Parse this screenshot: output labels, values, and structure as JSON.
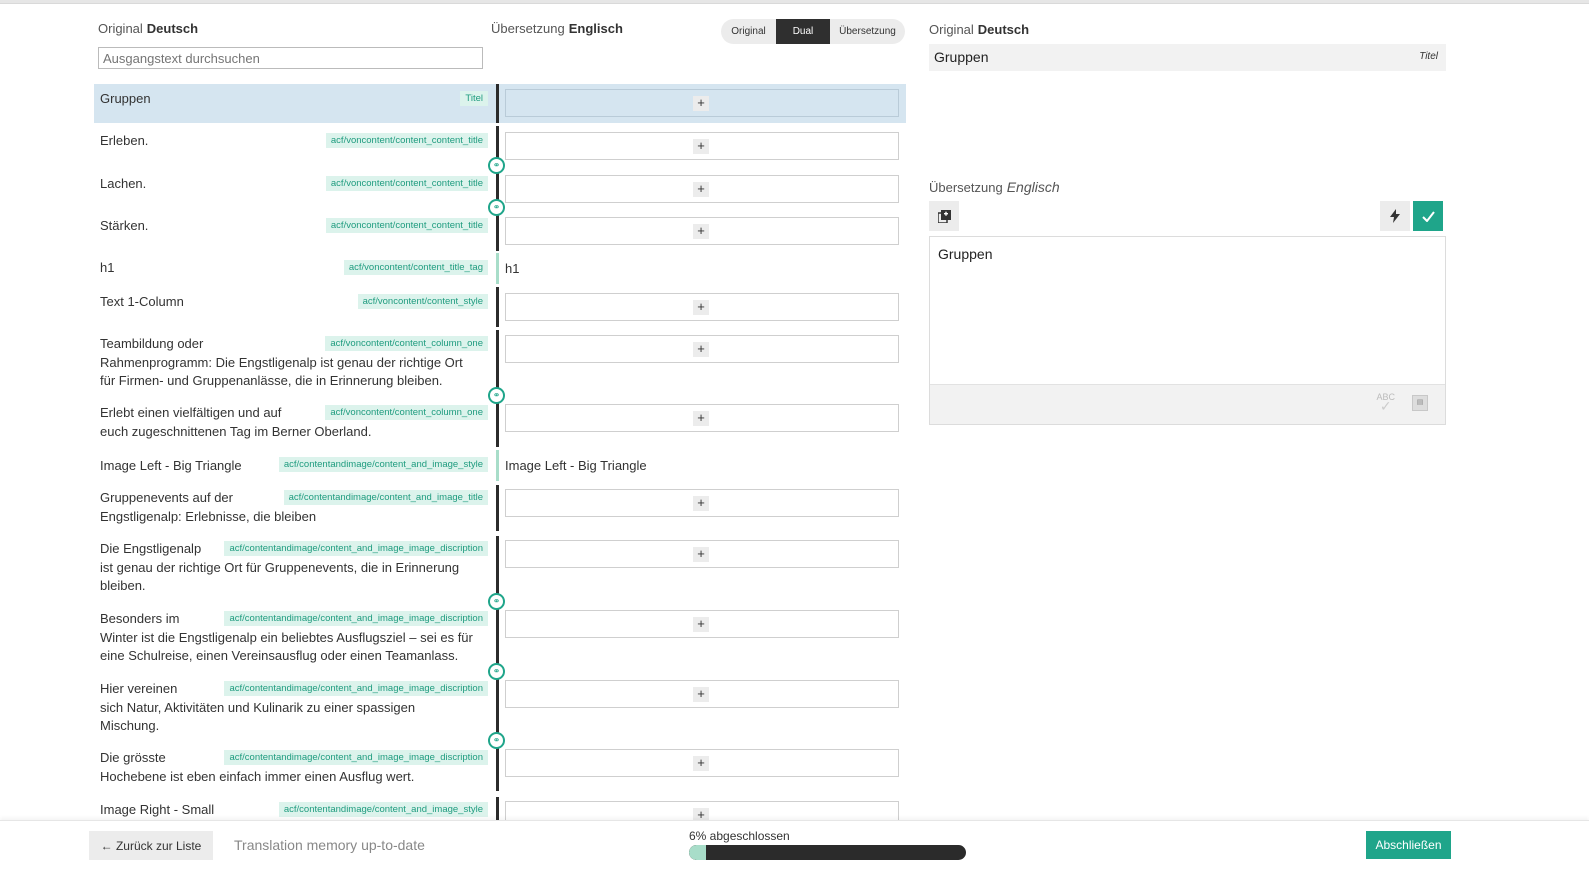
{
  "left": {
    "original_label": "Original",
    "original_lang": "Deutsch",
    "translation_label": "Übersetzung",
    "translation_lang": "Englisch",
    "search_placeholder": "Ausgangstext durchsuchen",
    "view_modes": [
      "Original",
      "Dual",
      "Übersetzung"
    ],
    "active_view": "Dual"
  },
  "rows": [
    {
      "src": "Gruppen",
      "tag": "Titel",
      "translation": ""
    },
    {
      "src": "Erleben.",
      "tag": "acf/voncontent/content_content_title",
      "translation": ""
    },
    {
      "src": "Lachen.",
      "tag": "acf/voncontent/content_content_title",
      "translation": ""
    },
    {
      "src": "Stärken.",
      "tag": "acf/voncontent/content_content_title",
      "translation": ""
    },
    {
      "src": "h1",
      "tag": "acf/voncontent/content_title_tag",
      "translation": "h1"
    },
    {
      "src": "Text 1-Column",
      "tag": "acf/voncontent/content_style",
      "translation": ""
    },
    {
      "src": "Teambildung oder\nRahmenprogramm: Die Engstligenalp ist genau der richtige Ort\nfür Firmen- und Gruppenanlässe, die in Erinnerung bleiben.",
      "tag": "acf/voncontent/content_column_one",
      "translation": ""
    },
    {
      "src": "Erlebt einen vielfältigen und auf\neuch zugeschnittenen Tag im Berner Oberland.",
      "tag": "acf/voncontent/content_column_one",
      "translation": ""
    },
    {
      "src": "Image Left - Big Triangle",
      "tag": "acf/contentandimage/content_and_image_style",
      "translation": "Image Left - Big Triangle"
    },
    {
      "src": "Gruppenevents auf der\nEngstligenalp: Erlebnisse, die bleiben",
      "tag": "acf/contentandimage/content_and_image_title",
      "translation": ""
    },
    {
      "src": "Die Engstligenalp\nist genau der richtige Ort für Gruppenevents, die in Erinnerung\nbleiben.",
      "tag": "acf/contentandimage/content_and_image_image_discription",
      "translation": ""
    },
    {
      "src": "Besonders im\nWinter ist die Engstligenalp ein beliebtes Ausflugsziel – sei es für\neine Schulreise, einen Vereinsausflug oder einen Teamanlass.",
      "tag": "acf/contentandimage/content_and_image_image_discription",
      "translation": ""
    },
    {
      "src": "Hier vereinen\nsich Natur, Aktivitäten und Kulinarik zu einer spassigen\nMischung.",
      "tag": "acf/contentandimage/content_and_image_image_discription",
      "translation": ""
    },
    {
      "src": "Die grösste\nHochebene ist eben einfach immer einen Ausflug wert.",
      "tag": "acf/contentandimage/content_and_image_image_discription",
      "translation": ""
    },
    {
      "src": "Image Right - Small",
      "tag": "acf/contentandimage/content_and_image_style",
      "translation": ""
    }
  ],
  "right": {
    "original_label": "Original",
    "original_lang": "Deutsch",
    "source_text": "Gruppen",
    "source_type": "Titel",
    "translation_label": "Übersetzung",
    "translation_lang": "Englisch",
    "translation_text": "Gruppen",
    "spell_label": "ABC"
  },
  "footer": {
    "back_label": "← Zurück zur Liste",
    "tm_status": "Translation memory up-to-date",
    "progress_label": "6% abgeschlossen",
    "progress_percent": 6,
    "finish_label": "Abschließen"
  },
  "colors": {
    "accent": "#1fa58a",
    "active_row": "#d5e5f0",
    "tag_bg": "#dcf3ec"
  }
}
